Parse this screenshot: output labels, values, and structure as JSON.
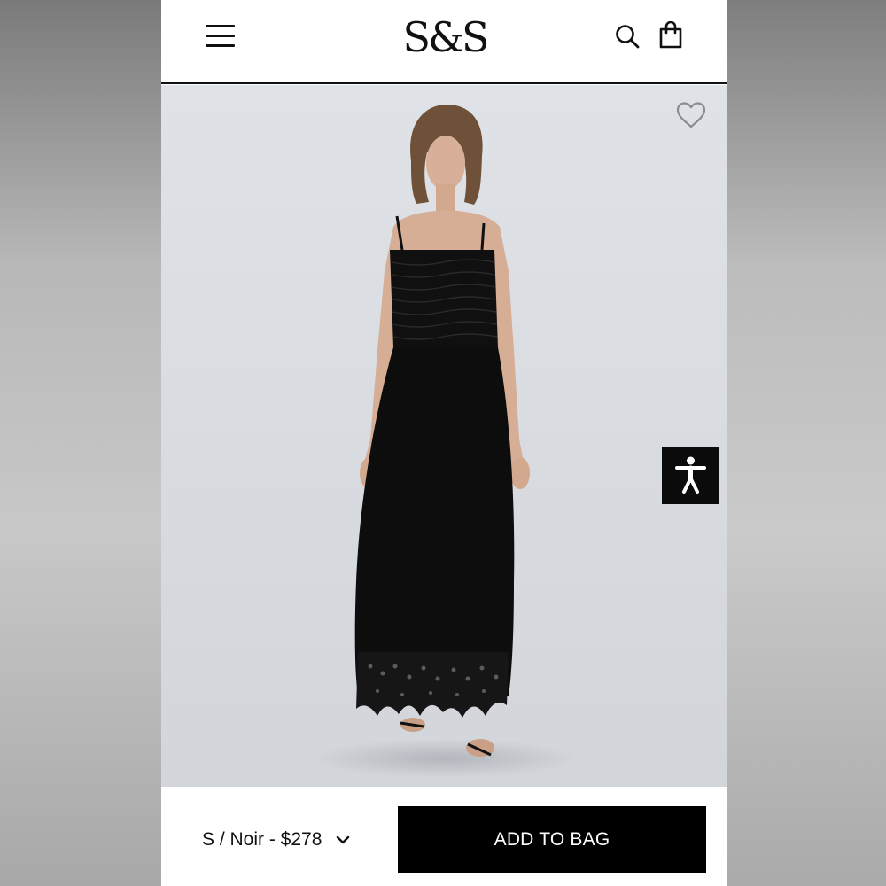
{
  "header": {
    "logo_text": "S&S",
    "menu_icon": "hamburger-menu-icon",
    "search_icon": "search-icon",
    "bag_icon": "shopping-bag-icon"
  },
  "product": {
    "wishlist_icon": "heart-outline-icon",
    "image_alt": "Model wearing black smocked maxi dress with eyelet scalloped hem",
    "background_color": "#d7dadf"
  },
  "accessibility": {
    "icon": "accessibility-person-icon"
  },
  "purchase_bar": {
    "variant_label": "S / Noir - $278",
    "add_to_bag_label": "ADD TO BAG",
    "button_color": "#000000",
    "chevron_icon": "chevron-down-icon"
  }
}
